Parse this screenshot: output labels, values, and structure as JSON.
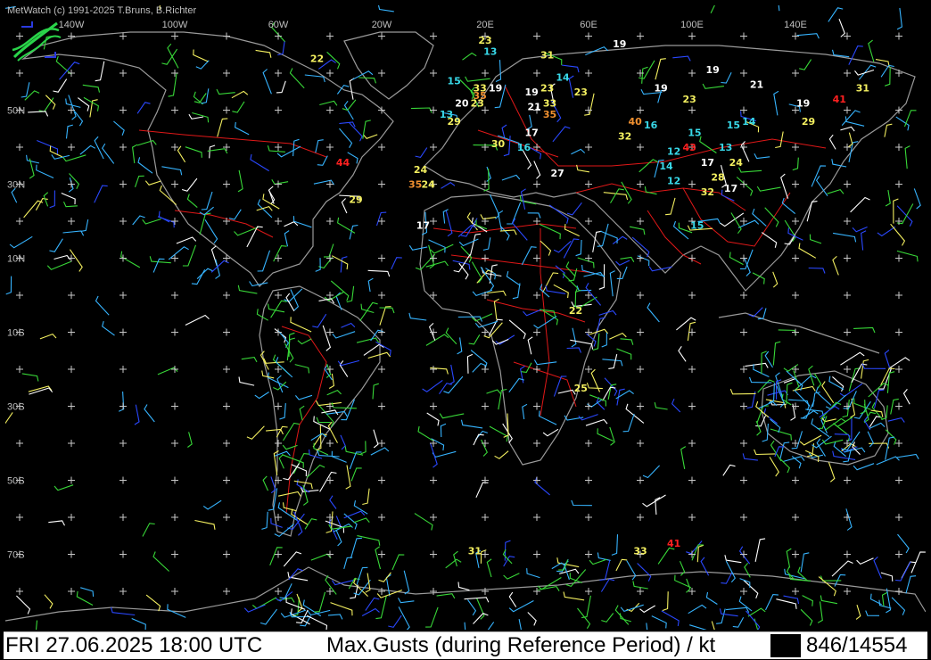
{
  "app": {
    "copyright": "MetWatch  (c) 1991-2025 T.Bruns, B.Richter"
  },
  "status_bar": {
    "datetime": "FRI 27.06.2025 18:00 UTC",
    "product": "Max.Gusts (during Reference Period) / kt",
    "count": "846/14554"
  },
  "colors": {
    "background": "#000000",
    "coast": "#9a9a9a",
    "borders": "#e01818",
    "grid": "#c8c8c8",
    "label_white": "#ffffff",
    "label_cyan": "#38d8e8",
    "label_yellow": "#f4f060",
    "label_orange": "#f09030",
    "label_red": "#ff2020"
  },
  "map": {
    "longitude_labels": [
      "140W",
      "100W",
      "60W",
      "20W",
      "20E",
      "60E",
      "100E",
      "140E"
    ],
    "latitude_labels": [
      "50N",
      "30N",
      "10N",
      "10S",
      "30S",
      "50S",
      "70S"
    ],
    "icons": [
      "metwatch-logo-icon"
    ],
    "gust_labels": [
      {
        "v": "22",
        "c": "yellow",
        "lon": -45,
        "lat": 63
      },
      {
        "v": "23",
        "c": "yellow",
        "lon": 20,
        "lat": 68
      },
      {
        "v": "13",
        "c": "cyan",
        "lon": 22,
        "lat": 65
      },
      {
        "v": "31",
        "c": "yellow",
        "lon": 44,
        "lat": 64
      },
      {
        "v": "19",
        "c": "white",
        "lon": 72,
        "lat": 67
      },
      {
        "v": "19",
        "c": "white",
        "lon": 108,
        "lat": 60
      },
      {
        "v": "15",
        "c": "cyan",
        "lon": 8,
        "lat": 57
      },
      {
        "v": "14",
        "c": "cyan",
        "lon": 50,
        "lat": 58
      },
      {
        "v": "33",
        "c": "yellow",
        "lon": 18,
        "lat": 55
      },
      {
        "v": "19",
        "c": "white",
        "lon": 24,
        "lat": 55
      },
      {
        "v": "35",
        "c": "orange",
        "lon": 18,
        "lat": 53
      },
      {
        "v": "19",
        "c": "white",
        "lon": 38,
        "lat": 54
      },
      {
        "v": "23",
        "c": "yellow",
        "lon": 44,
        "lat": 55
      },
      {
        "v": "23",
        "c": "yellow",
        "lon": 57,
        "lat": 54
      },
      {
        "v": "19",
        "c": "white",
        "lon": 88,
        "lat": 55
      },
      {
        "v": "21",
        "c": "white",
        "lon": 125,
        "lat": 56
      },
      {
        "v": "31",
        "c": "yellow",
        "lon": 166,
        "lat": 55
      },
      {
        "v": "41",
        "c": "red",
        "lon": 157,
        "lat": 52
      },
      {
        "v": "20",
        "c": "white",
        "lon": 11,
        "lat": 51
      },
      {
        "v": "23",
        "c": "yellow",
        "lon": 17,
        "lat": 51
      },
      {
        "v": "21",
        "c": "white",
        "lon": 39,
        "lat": 50
      },
      {
        "v": "33",
        "c": "yellow",
        "lon": 45,
        "lat": 51
      },
      {
        "v": "35",
        "c": "orange",
        "lon": 45,
        "lat": 48
      },
      {
        "v": "23",
        "c": "yellow",
        "lon": 99,
        "lat": 52
      },
      {
        "v": "19",
        "c": "white",
        "lon": 143,
        "lat": 51
      },
      {
        "v": "13",
        "c": "cyan",
        "lon": 5,
        "lat": 48
      },
      {
        "v": "29",
        "c": "yellow",
        "lon": 8,
        "lat": 46
      },
      {
        "v": "40",
        "c": "orange",
        "lon": 78,
        "lat": 46
      },
      {
        "v": "16",
        "c": "cyan",
        "lon": 84,
        "lat": 45
      },
      {
        "v": "15",
        "c": "cyan",
        "lon": 101,
        "lat": 43
      },
      {
        "v": "15",
        "c": "cyan",
        "lon": 116,
        "lat": 45
      },
      {
        "v": "14",
        "c": "cyan",
        "lon": 122,
        "lat": 46
      },
      {
        "v": "29",
        "c": "yellow",
        "lon": 145,
        "lat": 46
      },
      {
        "v": "17",
        "c": "white",
        "lon": 38,
        "lat": 43
      },
      {
        "v": "32",
        "c": "yellow",
        "lon": 74,
        "lat": 42
      },
      {
        "v": "30",
        "c": "yellow",
        "lon": 25,
        "lat": 40
      },
      {
        "v": "16",
        "c": "cyan",
        "lon": 35,
        "lat": 39
      },
      {
        "v": "12",
        "c": "cyan",
        "lon": 93,
        "lat": 38
      },
      {
        "v": "43",
        "c": "red",
        "lon": 99,
        "lat": 39
      },
      {
        "v": "13",
        "c": "cyan",
        "lon": 113,
        "lat": 39
      },
      {
        "v": "44",
        "c": "red",
        "lon": -35,
        "lat": 35
      },
      {
        "v": "17",
        "c": "white",
        "lon": 106,
        "lat": 35
      },
      {
        "v": "24",
        "c": "yellow",
        "lon": 117,
        "lat": 35
      },
      {
        "v": "24",
        "c": "yellow",
        "lon": -5,
        "lat": 33
      },
      {
        "v": "27",
        "c": "white",
        "lon": 48,
        "lat": 32
      },
      {
        "v": "14",
        "c": "cyan",
        "lon": 90,
        "lat": 34
      },
      {
        "v": "35",
        "c": "orange",
        "lon": -7,
        "lat": 29
      },
      {
        "v": "24",
        "c": "yellow",
        "lon": -2,
        "lat": 29
      },
      {
        "v": "12",
        "c": "cyan",
        "lon": 93,
        "lat": 30
      },
      {
        "v": "28",
        "c": "yellow",
        "lon": 110,
        "lat": 31
      },
      {
        "v": "17",
        "c": "white",
        "lon": 115,
        "lat": 28
      },
      {
        "v": "32",
        "c": "yellow",
        "lon": 106,
        "lat": 27
      },
      {
        "v": "29",
        "c": "yellow",
        "lon": -30,
        "lat": 25
      },
      {
        "v": "17",
        "c": "white",
        "lon": -4,
        "lat": 18
      },
      {
        "v": "15",
        "c": "cyan",
        "lon": 102,
        "lat": 18
      },
      {
        "v": "22",
        "c": "yellow",
        "lon": 55,
        "lat": -5
      },
      {
        "v": "25",
        "c": "yellow",
        "lon": 57,
        "lat": -26
      },
      {
        "v": "31",
        "c": "yellow",
        "lon": 16,
        "lat": -70
      },
      {
        "v": "41",
        "c": "red",
        "lon": 93,
        "lat": -68
      },
      {
        "v": "33",
        "c": "yellow",
        "lon": 80,
        "lat": -70
      }
    ]
  }
}
